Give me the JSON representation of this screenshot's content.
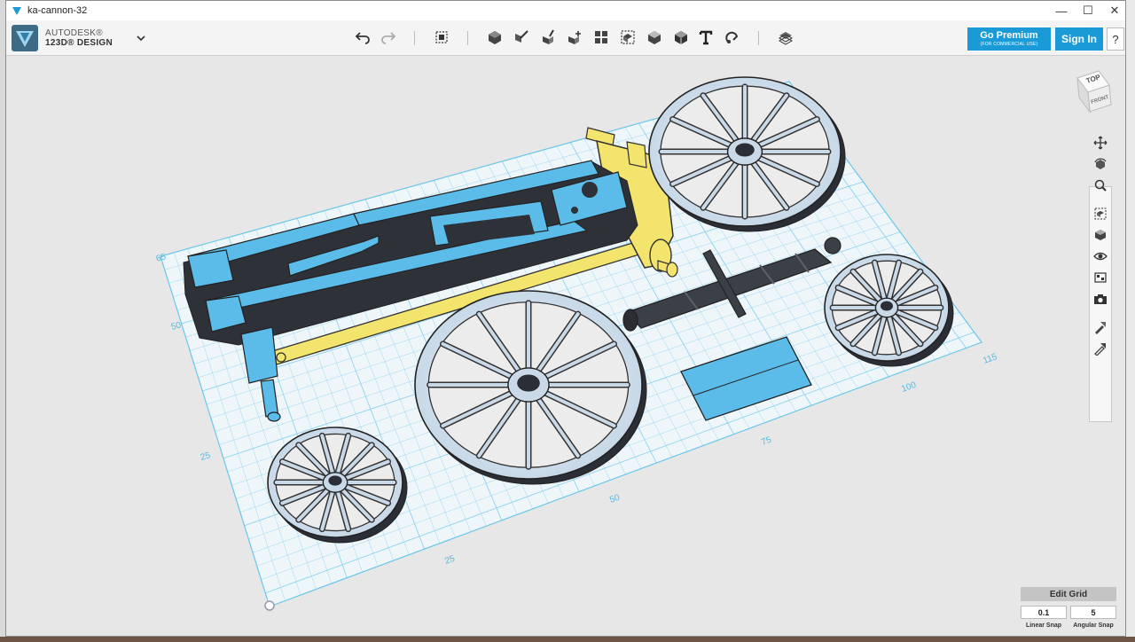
{
  "window": {
    "title": "ka-cannon-32",
    "min_glyph": "—",
    "max_glyph": "☐",
    "close_glyph": "✕"
  },
  "logo": {
    "line1": "AUTODESK®",
    "line2": "123D® DESIGN"
  },
  "toolbar": {
    "icons": [
      "undo-icon",
      "redo-icon",
      "transform-icon",
      "primitives-icon",
      "sketch-icon",
      "construct-icon",
      "modify-icon",
      "pattern-icon",
      "grouping-icon",
      "combine-icon",
      "measure-icon",
      "text-icon",
      "snap-icon",
      "material-icon"
    ]
  },
  "header_buttons": {
    "premium_label": "Go Premium",
    "premium_sub": "(FOR COMMERCIAL USE)",
    "signin_label": "Sign In",
    "help_label": "?"
  },
  "view_cube": {
    "top_label": "TOP",
    "front_label": "FRONT"
  },
  "nav_tools": [
    "pan-icon",
    "orbit-icon",
    "zoom-icon",
    "fit-icon",
    "view-icon",
    "visibility-icon",
    "material-view-icon",
    "camera-icon",
    "tool-a-icon",
    "tool-b-icon"
  ],
  "grid_labels": {
    "left": [
      "65",
      "50",
      "25"
    ],
    "bottom": [
      "25",
      "50",
      "75",
      "100",
      "115"
    ]
  },
  "grid_controls": {
    "edit_grid_label": "Edit Grid",
    "linear_snap_value": "0.1",
    "angular_snap_value": "5",
    "linear_snap_label": "Linear Snap",
    "angular_snap_label": "Angular Snap"
  },
  "colors": {
    "accent": "#1a9bd7",
    "part_blue": "#5bbcea",
    "part_yellow": "#f2e46c",
    "part_dark": "#3b3f46",
    "wheel_face": "#d6e3ee",
    "grid_line": "#8fd3ef"
  }
}
